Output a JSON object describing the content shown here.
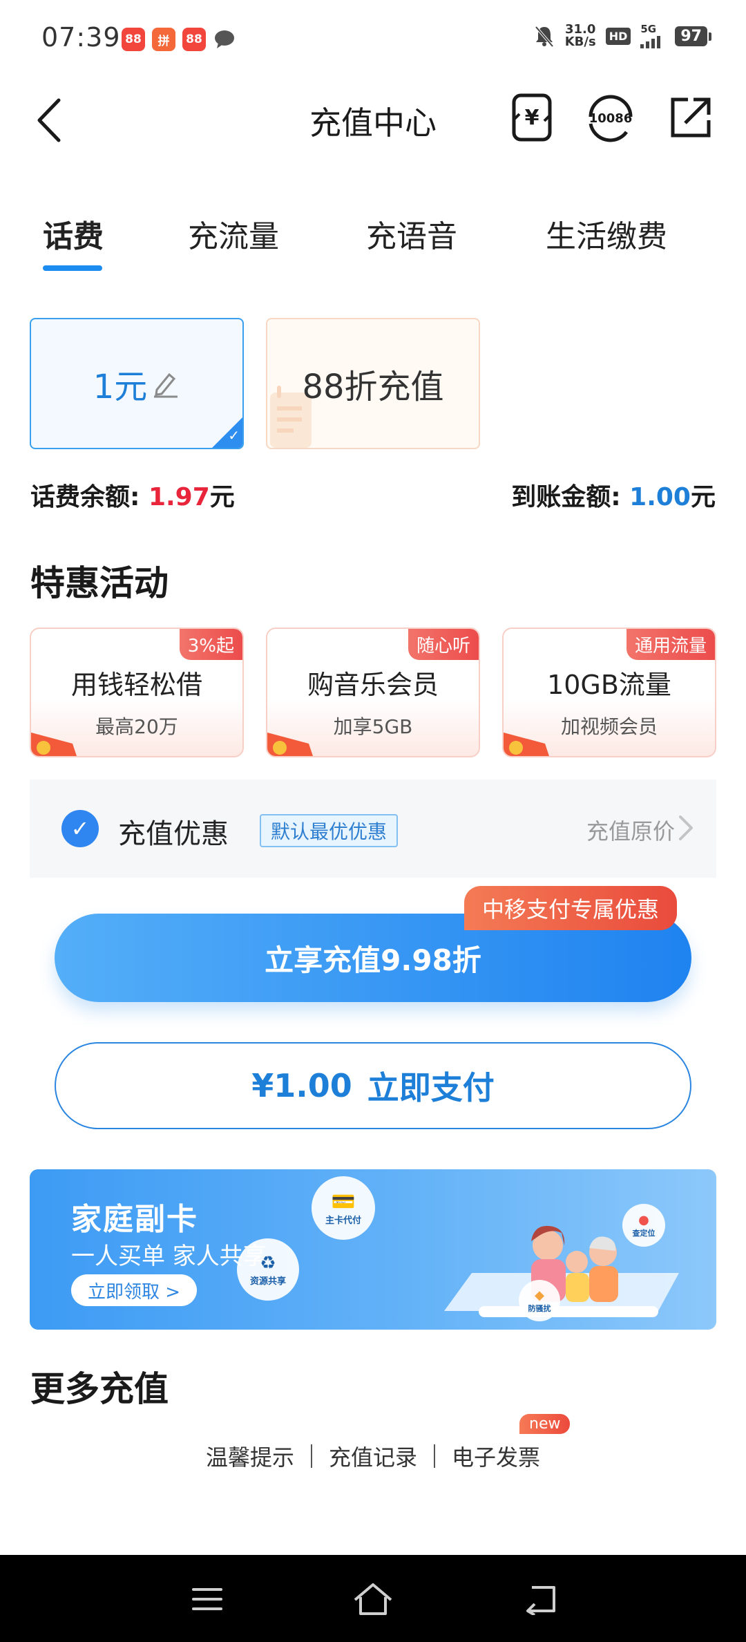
{
  "status_bar": {
    "time": "07:39",
    "net_speed_value": "31.0",
    "net_speed_unit": "KB/s",
    "hd": "HD",
    "signal": "5G",
    "battery": "97",
    "app_icons": [
      {
        "label": "88",
        "color": "#f2453c"
      },
      {
        "label": "拼",
        "color": "#f4683a"
      },
      {
        "label": "88",
        "color": "#f2453c"
      }
    ]
  },
  "header": {
    "title": "充值中心",
    "service_number": "10086"
  },
  "tabs": [
    {
      "label": "话费",
      "active": true
    },
    {
      "label": "充流量",
      "active": false
    },
    {
      "label": "充语音",
      "active": false
    },
    {
      "label": "生活缴费",
      "active": false
    }
  ],
  "amount_options": {
    "custom": "1元",
    "discount": "88折充值"
  },
  "balance": {
    "label": "话费余额:",
    "value": "1.97",
    "unit": "元"
  },
  "arrival": {
    "label": "到账金额:",
    "value": "1.00",
    "unit": "元"
  },
  "specials": {
    "title": "特惠活动",
    "cards": [
      {
        "badge": "3%起",
        "title": "用钱轻松借",
        "sub": "最高20万"
      },
      {
        "badge": "随心听",
        "title": "购音乐会员",
        "sub": "加享5GB"
      },
      {
        "badge": "通用流量",
        "title": "10GB流量",
        "sub": "加视频会员"
      }
    ]
  },
  "discount": {
    "label": "充值优惠",
    "tag": "默认最优优惠",
    "original": "充值原价"
  },
  "buttons": {
    "exclusive_badge": "中移支付专属优惠",
    "primary": "立享充值9.98折",
    "pay_amount": "¥1.00",
    "pay_label": "立即支付"
  },
  "banner": {
    "title": "家庭副卡",
    "subtitle": "一人买单 家人共享",
    "cta": "立即领取 >",
    "bubbles": [
      "主卡代付",
      "资源共享",
      "查定位",
      "防骚扰"
    ]
  },
  "more": {
    "title": "更多充值",
    "links": [
      "温馨提示",
      "充值记录",
      "电子发票"
    ],
    "new_badge": "new"
  },
  "colors": {
    "accent": "#1d8cf0",
    "price_red": "#e8253a",
    "badge_orange": "#ec4a3c"
  }
}
